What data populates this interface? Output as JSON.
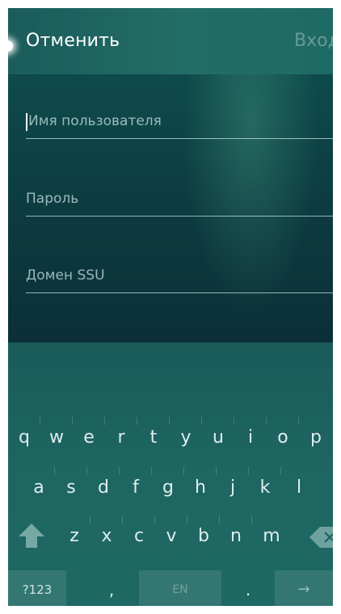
{
  "header": {
    "cancel_label": "Отменить",
    "login_label": "Вход"
  },
  "form": {
    "fields": [
      {
        "placeholder": "Имя пользователя",
        "focused": true
      },
      {
        "placeholder": "Пароль",
        "focused": false
      },
      {
        "placeholder": "Домен SSU",
        "focused": false
      }
    ]
  },
  "keyboard": {
    "rows": [
      [
        "q",
        "w",
        "e",
        "r",
        "t",
        "y",
        "u",
        "i",
        "o",
        "p"
      ],
      [
        "a",
        "s",
        "d",
        "f",
        "g",
        "h",
        "j",
        "k",
        "l"
      ],
      [
        "z",
        "x",
        "c",
        "v",
        "b",
        "n",
        "m"
      ]
    ],
    "symbols_label": "?123",
    "comma_label": ",",
    "language_label": "EN",
    "period_label": ".",
    "enter_label": "→",
    "shift_icon": "shift-arrow-icon",
    "backspace_icon": "backspace-icon"
  },
  "colors": {
    "header_bg": "#1f6763",
    "form_bg": "#0c3a40",
    "keyboard_bg": "#1d6361",
    "text": "#ffffff",
    "dim_text": "rgba(255,255,255,0.32)"
  }
}
